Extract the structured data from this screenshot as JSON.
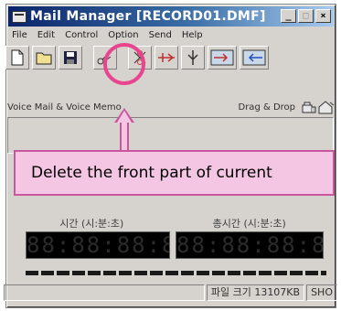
{
  "window": {
    "title": "Mail Manager [RECORD01.DMF]",
    "controls": {
      "minimize": "_",
      "maximize": "□",
      "close": "×"
    }
  },
  "menu": [
    "File",
    "Edit",
    "Control",
    "Option",
    "Send",
    "Help"
  ],
  "toolbar": {
    "icons": [
      "new-file-icon",
      "open-folder-icon",
      "save-icon",
      "cut-front-icon",
      "cut-back-icon",
      "merge-icon",
      "split-icon",
      "send-icon",
      "receive-icon"
    ]
  },
  "subbar": {
    "left_label": "Voice Mail & Voice Memo",
    "right_label": "Drag & Drop"
  },
  "callout": {
    "text": "Delete  the  front part of current"
  },
  "time_labels": {
    "current": "시간 (시:분:초)",
    "total": "총시간 (시:분:초)"
  },
  "displays": {
    "current": "88:88:88:88",
    "total": "88:88:88:88"
  },
  "status": {
    "left": "",
    "file_size": "파일 크기 13107KB",
    "mode": "SHO"
  },
  "colors": {
    "highlight": "#e8458e",
    "callout_fill": "#f5c6e4",
    "titlebar": "#0a246a"
  }
}
